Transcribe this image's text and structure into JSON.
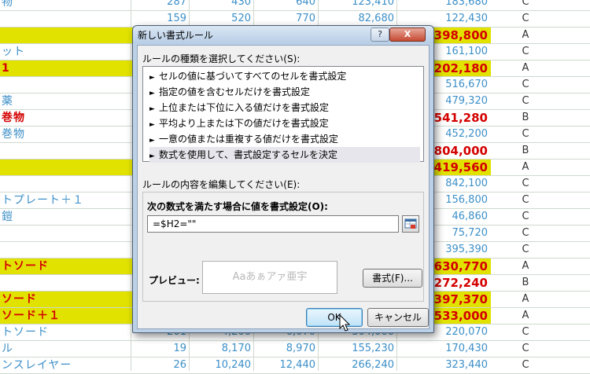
{
  "sheet": {
    "rows": [
      {
        "name": "物",
        "n1": "287",
        "n2": "430",
        "n3": "640",
        "n4": "123,410",
        "total": "183,680",
        "rank": "C",
        "hl": false,
        "red": false,
        "big": false
      },
      {
        "name": "",
        "n1": "159",
        "n2": "520",
        "n3": "770",
        "n4": "82,680",
        "total": "122,430",
        "rank": "C",
        "hl": false,
        "red": false,
        "big": false
      },
      {
        "name": "",
        "n1": "",
        "n2": "",
        "n3": "",
        "n4": "",
        "total": "398,800",
        "rank": "A",
        "hl": true,
        "red": false,
        "big": true
      },
      {
        "name": "ット",
        "n1": "",
        "n2": "",
        "n3": "",
        "n4": "",
        "total": "161,100",
        "rank": "C",
        "hl": false,
        "red": false,
        "big": false
      },
      {
        "name": "1",
        "n1": "",
        "n2": "",
        "n3": "",
        "n4": "",
        "total": "202,180",
        "rank": "A",
        "hl": true,
        "red": true,
        "big": true
      },
      {
        "name": "",
        "n1": "",
        "n2": "",
        "n3": "",
        "n4": "",
        "total": "516,670",
        "rank": "C",
        "hl": false,
        "red": false,
        "big": false
      },
      {
        "name": "薬",
        "n1": "",
        "n2": "",
        "n3": "",
        "n4": "",
        "total": "479,320",
        "rank": "C",
        "hl": false,
        "red": false,
        "big": false
      },
      {
        "name": "巻物",
        "n1": "",
        "n2": "",
        "n3": "",
        "n4": "",
        "total": "541,280",
        "rank": "B",
        "hl": false,
        "red": true,
        "big": true
      },
      {
        "name": "巻物",
        "n1": "",
        "n2": "",
        "n3": "",
        "n4": "",
        "total": "452,200",
        "rank": "C",
        "hl": false,
        "red": false,
        "big": false
      },
      {
        "name": "",
        "n1": "",
        "n2": "",
        "n3": "",
        "n4": "",
        "total": "804,000",
        "rank": "B",
        "hl": false,
        "red": false,
        "big": true
      },
      {
        "name": "",
        "n1": "",
        "n2": "",
        "n3": "",
        "n4": "",
        "total": "419,560",
        "rank": "A",
        "hl": true,
        "red": false,
        "big": true
      },
      {
        "name": "",
        "n1": "",
        "n2": "",
        "n3": "",
        "n4": "",
        "total": "842,100",
        "rank": "C",
        "hl": false,
        "red": false,
        "big": false
      },
      {
        "name": "トプレート＋１",
        "n1": "",
        "n2": "",
        "n3": "",
        "n4": "",
        "total": "156,800",
        "rank": "C",
        "hl": false,
        "red": false,
        "big": false
      },
      {
        "name": "鎧",
        "n1": "",
        "n2": "",
        "n3": "",
        "n4": "",
        "total": "46,860",
        "rank": "C",
        "hl": false,
        "red": false,
        "big": false
      },
      {
        "name": "",
        "n1": "",
        "n2": "",
        "n3": "",
        "n4": "",
        "total": "75,720",
        "rank": "C",
        "hl": false,
        "red": false,
        "big": false
      },
      {
        "name": "",
        "n1": "",
        "n2": "",
        "n3": "",
        "n4": "",
        "total": "395,390",
        "rank": "C",
        "hl": false,
        "red": false,
        "big": false
      },
      {
        "name": "トソード",
        "n1": "",
        "n2": "",
        "n3": "",
        "n4": "",
        "total": "630,770",
        "rank": "A",
        "hl": true,
        "red": true,
        "big": true
      },
      {
        "name": "",
        "n1": "",
        "n2": "",
        "n3": "",
        "n4": "",
        "total": "272,240",
        "rank": "B",
        "hl": false,
        "red": false,
        "big": true
      },
      {
        "name": "ソード",
        "n1": "",
        "n2": "",
        "n3": "",
        "n4": "",
        "total": "397,370",
        "rank": "A",
        "hl": true,
        "red": true,
        "big": true
      },
      {
        "name": "ソード＋１",
        "n1": "",
        "n2": "",
        "n3": "",
        "n4": "",
        "total": "533,000",
        "rank": "A",
        "hl": true,
        "red": true,
        "big": true
      },
      {
        "name": "トソード",
        "n1": "201",
        "n2": "4,200",
        "n3": "6,070",
        "n4": "304,000",
        "total": "220,070",
        "rank": "C",
        "hl": false,
        "red": false,
        "big": false
      },
      {
        "name": "ル",
        "n1": "19",
        "n2": "8,170",
        "n3": "8,970",
        "n4": "155,230",
        "total": "170,430",
        "rank": "C",
        "hl": false,
        "red": false,
        "big": false
      },
      {
        "name": "ンスレイヤー",
        "n1": "26",
        "n2": "10,240",
        "n3": "12,440",
        "n4": "266,240",
        "total": "323,440",
        "rank": "C",
        "hl": false,
        "red": false,
        "big": false
      }
    ]
  },
  "dialog": {
    "title": "新しい書式ルール",
    "help": "?",
    "close": "X",
    "rule_type_label": "ルールの種類を選択してください(S):",
    "rule_types": [
      "セルの値に基づいてすべてのセルを書式設定",
      "指定の値を含むセルだけを書式設定",
      "上位または下位に入る値だけを書式設定",
      "平均より上または下の値だけを書式設定",
      "一意の値または重複する値だけを書式設定",
      "数式を使用して、書式設定するセルを決定"
    ],
    "rule_arrow": "►",
    "description_label": "ルールの内容を編集してください(E):",
    "formula_label": "次の数式を満たす場合に値を書式設定(O):",
    "formula_value": "=$H2=\"\"",
    "preview_label": "プレビュー:",
    "preview_sample": "Aaあぁアァ亜宇",
    "format_button": "書式(F)...",
    "ok_button": "OK",
    "cancel_button": "キャンセル"
  },
  "colors": {
    "highlight": "#e2e200",
    "accent_text": "#3c8fc8",
    "alert_text": "#d40000"
  }
}
